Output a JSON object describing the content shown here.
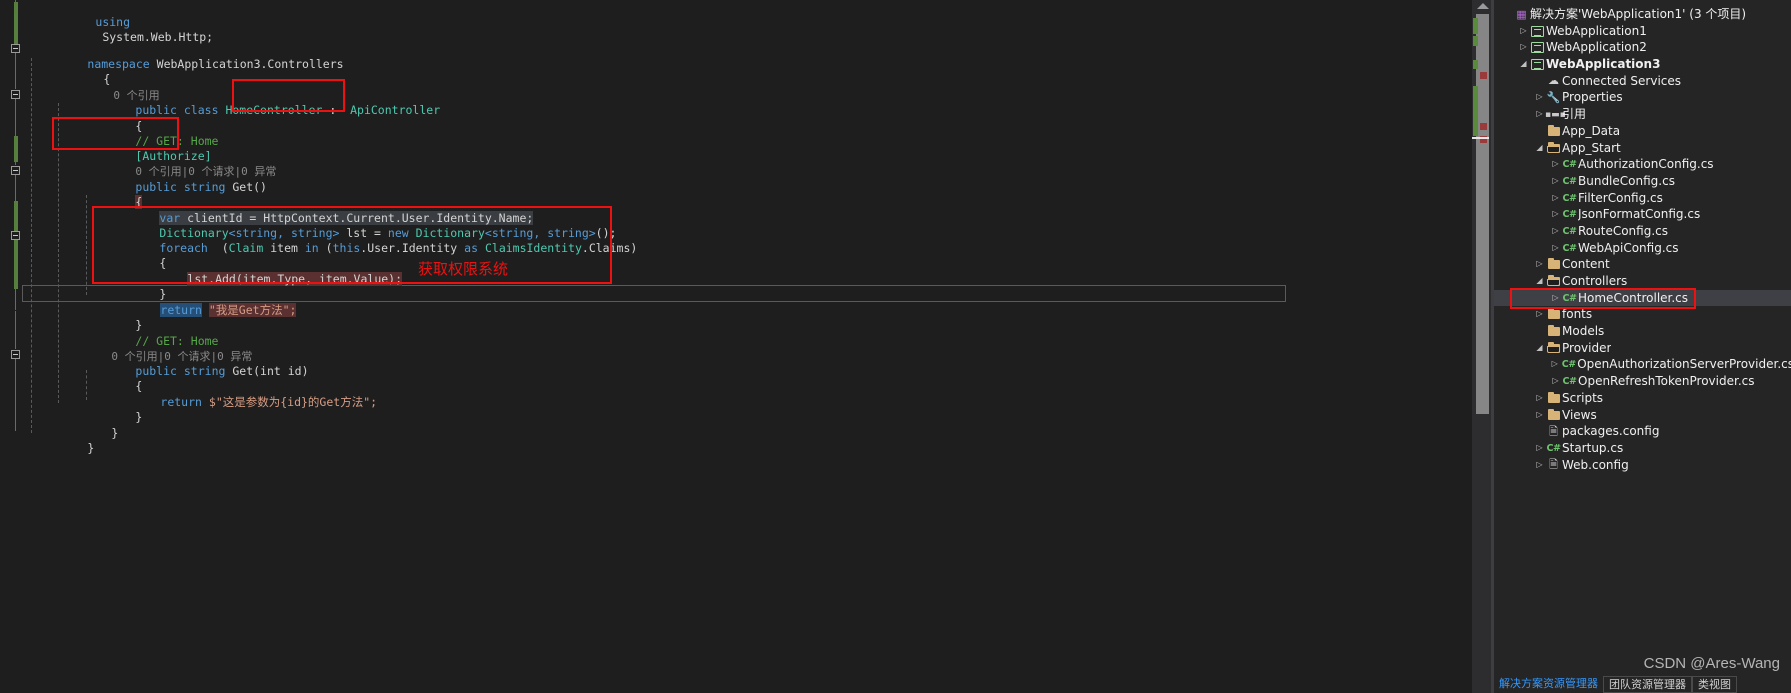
{
  "app": {
    "theme_background": "#1e1e1e",
    "accent": "#3399ff",
    "annotation_color": "#ee1111"
  },
  "editor": {
    "language": "csharp",
    "current_line_number": 20,
    "lines": [
      {
        "id": "l1",
        "text": "using System.Web.Http;"
      },
      {
        "id": "l2",
        "text": ""
      },
      {
        "id": "l3",
        "text": ""
      },
      {
        "id": "l4",
        "text": "namespace WebApplication3.Controllers"
      },
      {
        "id": "l5",
        "text": "{"
      },
      {
        "id": "l6",
        "text": "    0 个引用"
      },
      {
        "id": "l7",
        "text": "    public class HomeController : ApiController"
      },
      {
        "id": "l8",
        "text": "    {"
      },
      {
        "id": "l9",
        "text": "        // GET: Home"
      },
      {
        "id": "l10",
        "text": "        [Authorize]"
      },
      {
        "id": "l11",
        "text": "        0 个引用 | 0 个请求 | 0 异常"
      },
      {
        "id": "l12",
        "text": "        public string Get()"
      },
      {
        "id": "l13",
        "text": "        {"
      },
      {
        "id": "l14",
        "text": "            var clientId = HttpContext.Current.User.Identity.Name;"
      },
      {
        "id": "l15",
        "text": "            Dictionary<string, string> lst = new Dictionary<string, string>();"
      },
      {
        "id": "l16",
        "text": "            foreach (Claim item in (this.User.Identity as ClaimsIdentity).Claims)"
      },
      {
        "id": "l17",
        "text": "            {"
      },
      {
        "id": "l18",
        "text": "                lst.Add(item.Type, item.Value);"
      },
      {
        "id": "l19",
        "text": "            }"
      },
      {
        "id": "l20",
        "text": "            return \"我是Get方法\";"
      },
      {
        "id": "l21",
        "text": "        }"
      },
      {
        "id": "l22",
        "text": "        // GET: Home"
      },
      {
        "id": "l23",
        "text": "        0 个引用 | 0 个请求 | 0 异常"
      },
      {
        "id": "l24",
        "text": "        public string Get(int id)"
      },
      {
        "id": "l25",
        "text": "        {"
      },
      {
        "id": "l26",
        "text": "            return $\"这是参数为{id}的Get方法\";"
      },
      {
        "id": "l27",
        "text": "        }"
      },
      {
        "id": "l28",
        "text": "    }"
      },
      {
        "id": "l29",
        "text": "}"
      }
    ],
    "tokens": {
      "using": "using",
      "using_ns": "System.Web.Http;",
      "namespace_kw": "namespace",
      "namespace_name": "WebApplication3.Controllers",
      "brace_open": "{",
      "brace_close": "}",
      "codelens_refs_0": "0 个引用",
      "codelens_full": "0 个引用|0 个请求|0 异常",
      "public": "public",
      "class": "class",
      "string": "string",
      "int": "int",
      "new": "new",
      "var": "var",
      "this": "this",
      "as": "as",
      "in": "in",
      "foreach": "foreach",
      "return": "return",
      "home_controller": "HomeController",
      "colon": ":",
      "api_controller": "ApiController",
      "comment_get_home": "// GET: Home",
      "attr_authorize": "[Authorize]",
      "get_sig": "Get()",
      "get_id_sig": "Get(int id)",
      "client_id_assign": "clientId = HttpContext.Current.User.Identity.Name;",
      "dictionary": "Dictionary",
      "dict_generic": "<string, string>",
      "lst_eq": "lst =",
      "dict_call": "();",
      "claim": "Claim",
      "claims_identity": "ClaimsIdentity",
      "item": "item",
      "user_identity": ".User.Identity",
      "claims": ".Claims)",
      "foreach_open": "(",
      "lst_add": "lst.Add(item.Type, item.Value);",
      "return_str": "\"我是Get方法\";",
      "interp_prefix": "$",
      "return_interp": "\"这是参数为{id}的Get方法\";"
    },
    "annotations": [
      {
        "id": "a1",
        "target": "ApiController base class"
      },
      {
        "id": "a2",
        "target": "Authorize attribute"
      },
      {
        "id": "a3",
        "target": "Claims loop block"
      }
    ],
    "annotation_label": "获取权限系统"
  },
  "scrollbar": {
    "name": "editor-vertical-scrollbar",
    "up_arrow": "▲",
    "thumb_position_percent": 2
  },
  "explorer": {
    "title": "解决方案资源管理器",
    "tree": [
      {
        "indent": 0,
        "arrow": "none",
        "icon": "solution-icon",
        "label": "解决方案'WebApplication1' (3 个项目)",
        "bold": false,
        "selected": false
      },
      {
        "indent": 1,
        "arrow": "closed",
        "icon": "project-icon",
        "label": "WebApplication1",
        "bold": false,
        "selected": false
      },
      {
        "indent": 1,
        "arrow": "closed",
        "icon": "project-icon",
        "label": "WebApplication2",
        "bold": false,
        "selected": false
      },
      {
        "indent": 1,
        "arrow": "open",
        "icon": "project-icon",
        "label": "WebApplication3",
        "bold": true,
        "selected": false
      },
      {
        "indent": 2,
        "arrow": "none",
        "icon": "cloud-icon",
        "label": "Connected Services",
        "bold": false,
        "selected": false
      },
      {
        "indent": 2,
        "arrow": "closed",
        "icon": "wrench-icon",
        "label": "Properties",
        "bold": false,
        "selected": false
      },
      {
        "indent": 2,
        "arrow": "closed",
        "icon": "references-icon",
        "label": "引用",
        "bold": false,
        "selected": false
      },
      {
        "indent": 2,
        "arrow": "none",
        "icon": "folder-icon",
        "label": "App_Data",
        "bold": false,
        "selected": false
      },
      {
        "indent": 2,
        "arrow": "open",
        "icon": "folder-open-icon",
        "label": "App_Start",
        "bold": false,
        "selected": false
      },
      {
        "indent": 3,
        "arrow": "closed",
        "icon": "csharp-file-icon",
        "label": "AuthorizationConfig.cs",
        "bold": false,
        "selected": false
      },
      {
        "indent": 3,
        "arrow": "closed",
        "icon": "csharp-file-icon",
        "label": "BundleConfig.cs",
        "bold": false,
        "selected": false
      },
      {
        "indent": 3,
        "arrow": "closed",
        "icon": "csharp-file-icon",
        "label": "FilterConfig.cs",
        "bold": false,
        "selected": false
      },
      {
        "indent": 3,
        "arrow": "closed",
        "icon": "csharp-file-icon",
        "label": "JsonFormatConfig.cs",
        "bold": false,
        "selected": false
      },
      {
        "indent": 3,
        "arrow": "closed",
        "icon": "csharp-file-icon",
        "label": "RouteConfig.cs",
        "bold": false,
        "selected": false
      },
      {
        "indent": 3,
        "arrow": "closed",
        "icon": "csharp-file-icon",
        "label": "WebApiConfig.cs",
        "bold": false,
        "selected": false
      },
      {
        "indent": 2,
        "arrow": "closed",
        "icon": "folder-icon",
        "label": "Content",
        "bold": false,
        "selected": false
      },
      {
        "indent": 2,
        "arrow": "open",
        "icon": "folder-open-icon",
        "label": "Controllers",
        "bold": false,
        "selected": false
      },
      {
        "indent": 3,
        "arrow": "closed",
        "icon": "csharp-file-icon",
        "label": "HomeController.cs",
        "bold": false,
        "selected": true
      },
      {
        "indent": 2,
        "arrow": "closed",
        "icon": "folder-icon",
        "label": "fonts",
        "bold": false,
        "selected": false
      },
      {
        "indent": 2,
        "arrow": "none",
        "icon": "folder-icon",
        "label": "Models",
        "bold": false,
        "selected": false
      },
      {
        "indent": 2,
        "arrow": "open",
        "icon": "folder-open-icon",
        "label": "Provider",
        "bold": false,
        "selected": false
      },
      {
        "indent": 3,
        "arrow": "closed",
        "icon": "csharp-file-icon",
        "label": "OpenAuthorizationServerProvider.cs",
        "bold": false,
        "selected": false
      },
      {
        "indent": 3,
        "arrow": "closed",
        "icon": "csharp-file-icon",
        "label": "OpenRefreshTokenProvider.cs",
        "bold": false,
        "selected": false
      },
      {
        "indent": 2,
        "arrow": "closed",
        "icon": "folder-icon",
        "label": "Scripts",
        "bold": false,
        "selected": false
      },
      {
        "indent": 2,
        "arrow": "closed",
        "icon": "folder-icon",
        "label": "Views",
        "bold": false,
        "selected": false
      },
      {
        "indent": 2,
        "arrow": "none",
        "icon": "config-file-icon",
        "label": "packages.config",
        "bold": false,
        "selected": false
      },
      {
        "indent": 2,
        "arrow": "closed",
        "icon": "csharp-file-icon",
        "label": "Startup.cs",
        "bold": false,
        "selected": false
      },
      {
        "indent": 2,
        "arrow": "closed",
        "icon": "config-file-icon",
        "label": "Web.config",
        "bold": false,
        "selected": false
      }
    ]
  },
  "tabs": [
    {
      "label": "解决方案资源管理器",
      "active": true,
      "boxed": false
    },
    {
      "label": "团队资源管理器",
      "active": false,
      "boxed": true
    },
    {
      "label": "类视图",
      "active": false,
      "boxed": true
    }
  ],
  "watermark": {
    "text": "CSDN @Ares-Wang"
  }
}
